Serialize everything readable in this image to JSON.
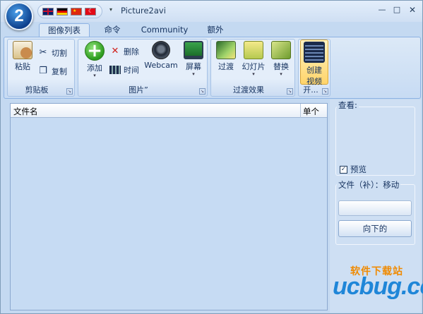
{
  "window": {
    "title": "Picture2avi",
    "orb_glyph": "2"
  },
  "tabs": [
    {
      "label": "图像列表",
      "active": true
    },
    {
      "label": "命令",
      "active": false
    },
    {
      "label": "Community",
      "active": false
    },
    {
      "label": "额外",
      "active": false
    }
  ],
  "ribbon": {
    "clipboard": {
      "label": "剪贴板",
      "paste": "粘贴",
      "cut": "切割",
      "copy": "复制"
    },
    "pictures": {
      "label": "图片”",
      "add": "添加",
      "delete": "删除",
      "time": "时间",
      "webcam": "Webcam",
      "screen": "屏幕"
    },
    "transitions": {
      "label": "过渡效果",
      "transition": "过渡",
      "slideshow": "幻灯片",
      "replace": "替换"
    },
    "start": {
      "label": "开...",
      "create_video_line1": "创建",
      "create_video_line2": "视频"
    }
  },
  "file_list": {
    "columns": [
      "文件名",
      "单个"
    ],
    "rows": []
  },
  "right_panel": {
    "view_label": "查看:",
    "preview_label": "预览",
    "preview_checked": true,
    "file_label": "文件（补）：移动",
    "input_value": "",
    "down_button": "向下的"
  },
  "watermark": {
    "site_name": "软件下载站",
    "logo": "ucbug.cc"
  },
  "colors": {
    "accent": "#15325f",
    "background": "#c4d9f1",
    "watermark_orange": "#f08a00",
    "watermark_blue": "#1f86d8"
  }
}
